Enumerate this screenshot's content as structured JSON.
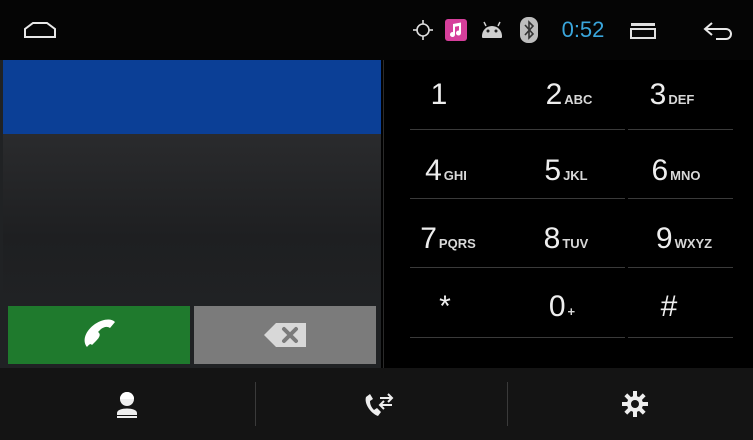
{
  "status_bar": {
    "time": "0:52",
    "icons": [
      "home-icon",
      "location-icon",
      "music-icon",
      "android-icon",
      "bluetooth-icon",
      "recent-apps-icon",
      "back-icon"
    ],
    "colors": {
      "time": "#3aa6dc",
      "music_badge": "#d63f9b"
    }
  },
  "dialer": {
    "number": "",
    "colors": {
      "number_bar": "#0b3f96",
      "call_button": "#1f7a2d",
      "delete_button": "#7b7b7b"
    }
  },
  "keypad": {
    "keys": [
      {
        "digit": "1",
        "letters": ""
      },
      {
        "digit": "2",
        "letters": "ABC"
      },
      {
        "digit": "3",
        "letters": "DEF"
      },
      {
        "digit": "4",
        "letters": "GHI"
      },
      {
        "digit": "5",
        "letters": "JKL"
      },
      {
        "digit": "6",
        "letters": "MNO"
      },
      {
        "digit": "7",
        "letters": "PQRS"
      },
      {
        "digit": "8",
        "letters": "TUV"
      },
      {
        "digit": "9",
        "letters": "WXYZ"
      },
      {
        "digit": "*",
        "letters": ""
      },
      {
        "digit": "0",
        "letters": "+"
      },
      {
        "digit": "#",
        "letters": ""
      }
    ]
  },
  "bottom_nav": {
    "items": [
      "contacts-icon",
      "call-log-icon",
      "settings-icon"
    ]
  }
}
